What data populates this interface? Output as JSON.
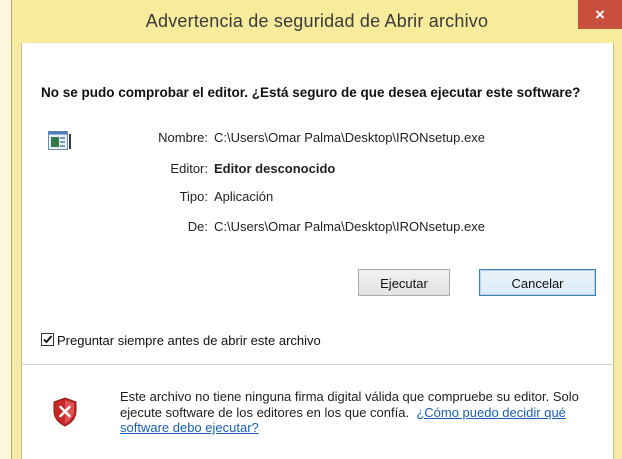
{
  "window": {
    "title": "Advertencia de seguridad de Abrir archivo",
    "close_glyph": "×",
    "close_icon": "close-icon"
  },
  "heading": "No se pudo comprobar el editor. ¿Está seguro de que desea ejecutar este software?",
  "file_icon": "application-file-icon",
  "details": [
    {
      "label": "Nombre:",
      "value": "C:\\Users\\Omar Palma\\Desktop\\IRONsetup.exe",
      "bold": false
    },
    {
      "label": "Editor:",
      "value": "Editor desconocido",
      "bold": true
    },
    {
      "label": "Tipo:",
      "value": "Aplicación",
      "bold": false
    },
    {
      "label": "De:",
      "value": "C:\\Users\\Omar Palma\\Desktop\\IRONsetup.exe",
      "bold": false
    }
  ],
  "buttons": {
    "run": "Ejecutar",
    "cancel": "Cancelar"
  },
  "checkbox": {
    "label": "Preguntar siempre antes de abrir este archivo",
    "checked": true,
    "check_glyph": "✔"
  },
  "warning": {
    "icon": "shield-error-icon",
    "text": "Este archivo no tiene ninguna firma digital válida que compruebe su editor. Solo ejecute software de los editores en los que confía.",
    "link": "¿Cómo puedo decidir qué software debo ejecutar?"
  },
  "colors": {
    "title_bar": "#f7eb9c",
    "close_button": "#c94f3d",
    "link": "#1a5fb4",
    "shield_red": "#c62828"
  }
}
